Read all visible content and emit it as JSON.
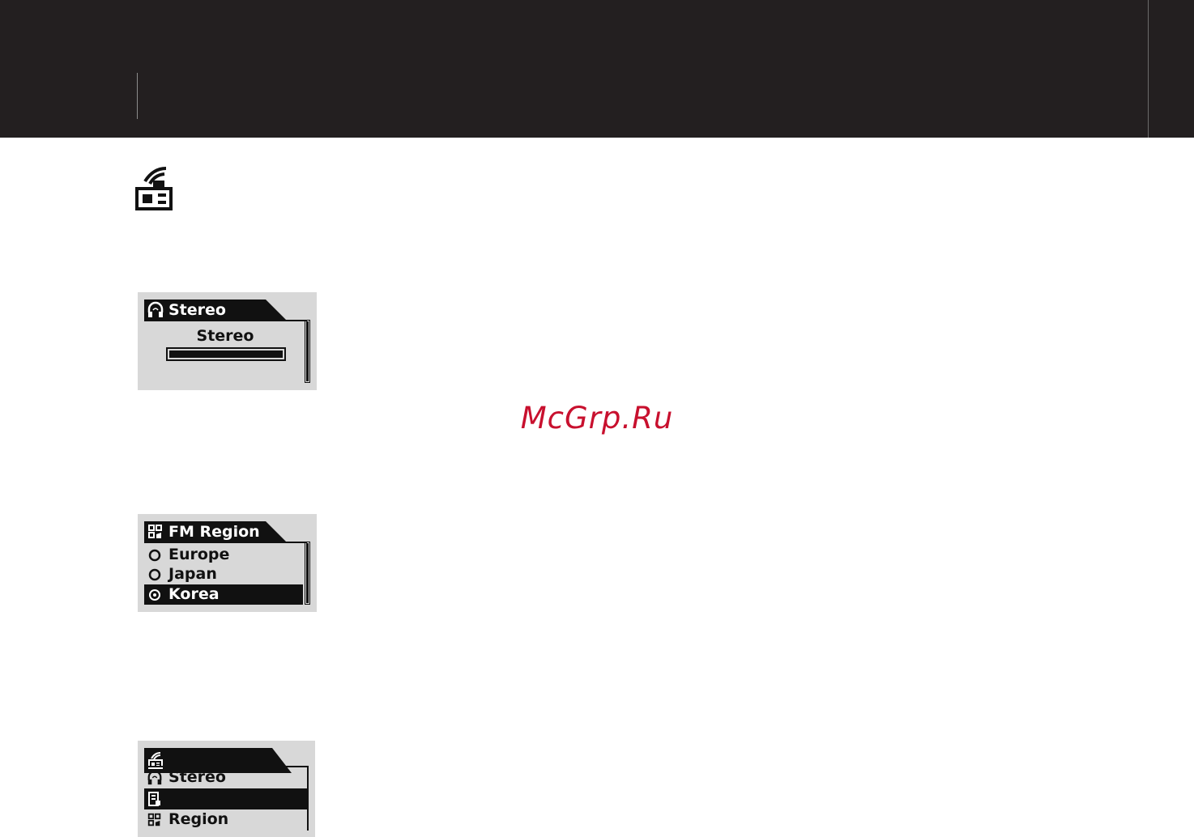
{
  "icons": {
    "section": "radio-icon",
    "headphones": "headphones-icon",
    "region": "region-grid-icon",
    "preset": "preset-icon",
    "radio_empty": "radio-empty-icon",
    "radio_selected": "radio-selected-icon"
  },
  "watermark": "McGrp.Ru",
  "screen_stereo": {
    "tab_title": "Stereo",
    "option_label": "Stereo",
    "level": 1.0
  },
  "screen_region": {
    "tab_title": "FM Region",
    "options": [
      {
        "label": "Europe",
        "selected": false
      },
      {
        "label": "Japan",
        "selected": false
      },
      {
        "label": "Korea",
        "selected": true
      }
    ]
  },
  "screen_menu": {
    "tab_title": "",
    "items": [
      {
        "label": "Stereo",
        "icon": "headphones-icon",
        "selected": false
      },
      {
        "label": "",
        "icon": "preset-icon",
        "selected": true
      },
      {
        "label": "Region",
        "icon": "region-grid-icon",
        "selected": false
      }
    ]
  }
}
